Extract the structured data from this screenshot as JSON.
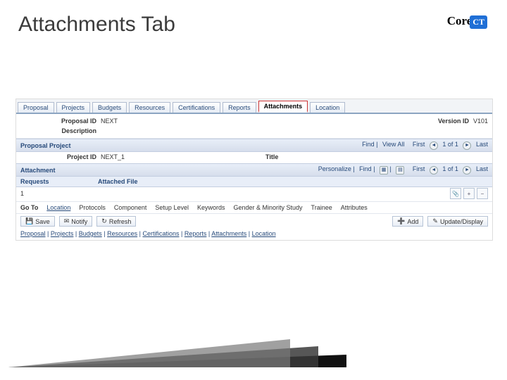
{
  "slide": {
    "title": "Attachments Tab"
  },
  "logo": {
    "brand": "Core",
    "suffix": "CT"
  },
  "tabs": [
    "Proposal",
    "Projects",
    "Budgets",
    "Resources",
    "Certifications",
    "Reports",
    "Attachments",
    "Location"
  ],
  "active_tab": "Attachments",
  "header_fields": {
    "proposal_id_label": "Proposal ID",
    "proposal_id_value": "NEXT",
    "version_id_label": "Version ID",
    "version_id_value": "V101",
    "description_label": "Description"
  },
  "proposal_project": {
    "bar_title": "Proposal Project",
    "find_label": "Find",
    "viewall_label": "View All",
    "first_label": "First",
    "count_text": "1 of 1",
    "last_label": "Last",
    "project_id_label": "Project ID",
    "project_id_value": "NEXT_1",
    "title_label": "Title"
  },
  "attachment": {
    "bar_title": "Attachment",
    "personalize": "Personalize",
    "find": "Find",
    "first_label": "First",
    "count_text": "1 of 1",
    "last_label": "Last",
    "col_requests": "Requests",
    "col_attached": "Attached File",
    "row_num": "1"
  },
  "goto": {
    "label": "Go To",
    "links": [
      "Location",
      "Protocols",
      "Component",
      "Setup Level",
      "Keywords",
      "Gender & Minority Study",
      "Trainee",
      "Attributes"
    ]
  },
  "buttons": {
    "save": "Save",
    "notify": "Notify",
    "refresh": "Refresh",
    "add": "Add",
    "update": "Update/Display"
  },
  "bottom_links": [
    "Proposal",
    "Projects",
    "Budgets",
    "Resources",
    "Certifications",
    "Reports",
    "Attachments",
    "Location"
  ]
}
